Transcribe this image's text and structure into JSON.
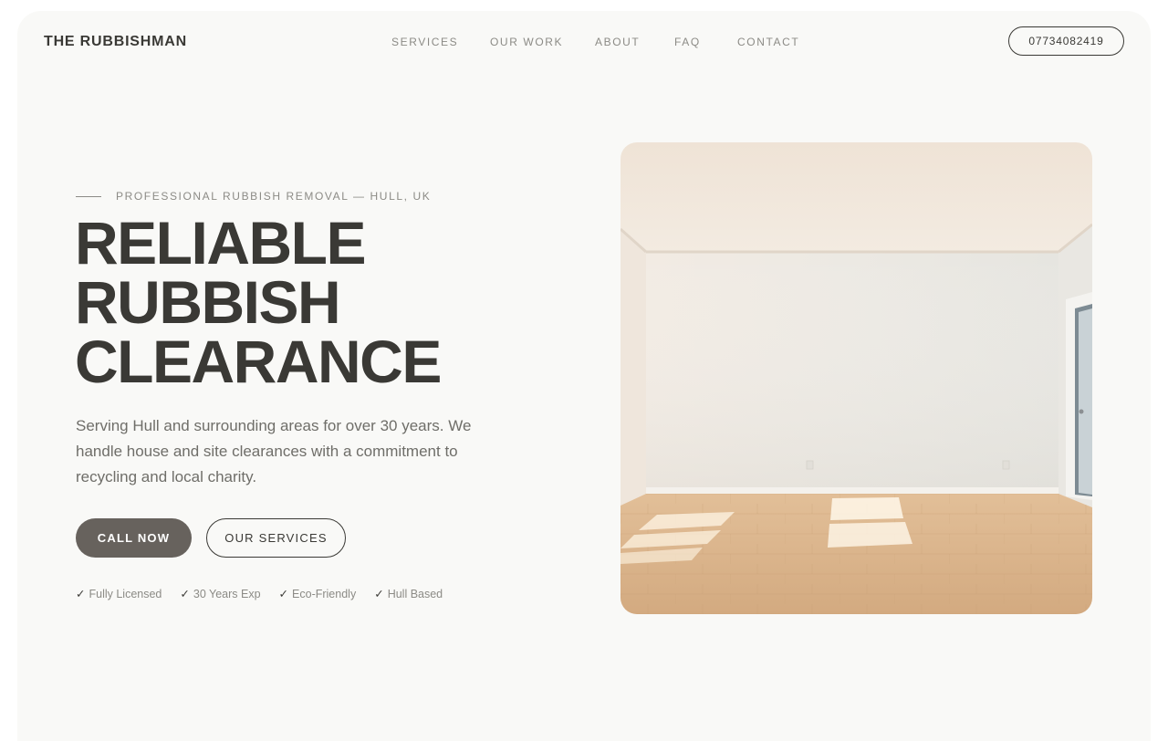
{
  "header": {
    "brand": "THE RUBBISHMAN",
    "nav": [
      "SERVICES",
      "OUR WORK",
      "ABOUT",
      "FAQ",
      "CONTACT"
    ],
    "phone": "07734082419"
  },
  "hero": {
    "eyebrow": "PROFESSIONAL RUBBISH REMOVAL — HULL, UK",
    "headline": [
      "RELIABLE",
      "RUBBISH",
      "CLEARANCE"
    ],
    "lead": "Serving Hull and surrounding areas for over 30 years. We handle house and site clearances with a commitment to recycling and local charity.",
    "primary_cta": "CALL NOW",
    "secondary_cta": "OUR SERVICES",
    "badges": [
      "Fully Licensed",
      "30 Years Exp",
      "Eco-Friendly",
      "Hull Based"
    ],
    "check_glyph": "✓",
    "image": {
      "subject": "empty room interior",
      "icon": "room-photo"
    }
  },
  "colors": {
    "page_bg": "#f9f9f7",
    "text_dark": "#3a3935",
    "text_muted": "#8c8b86",
    "primary_button": "#67625d"
  }
}
